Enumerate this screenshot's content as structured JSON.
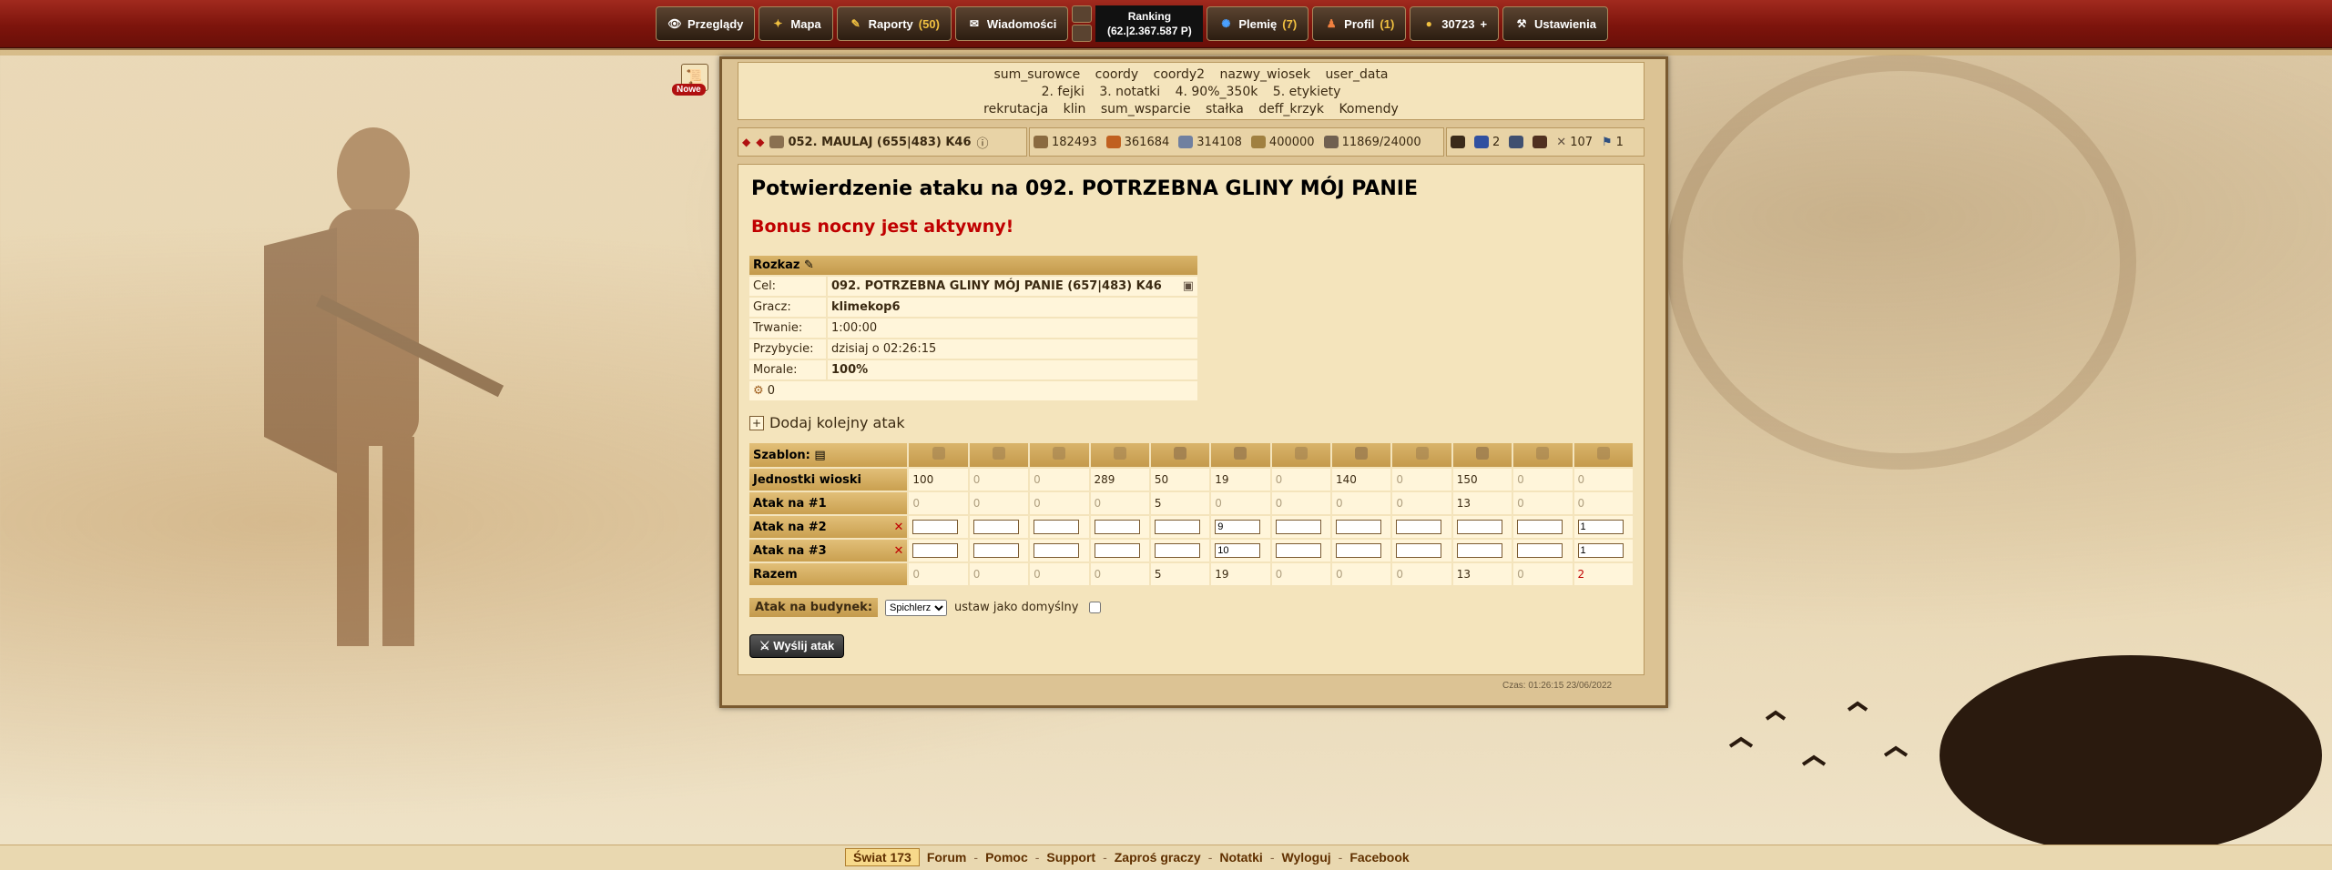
{
  "topbar": {
    "menu": [
      {
        "label": "Przeglądy",
        "count": ""
      },
      {
        "label": "Mapa",
        "count": ""
      },
      {
        "label": "Raporty",
        "count": "(50)"
      },
      {
        "label": "Wiadomości",
        "count": ""
      }
    ],
    "ranking_label": "Ranking",
    "ranking_value": "(62.|2.367.587 P)",
    "menu2": [
      {
        "label": "Plemię",
        "count": "(7)"
      },
      {
        "label": "Profil",
        "count": "(1)"
      },
      {
        "label": "30723",
        "count": "+"
      },
      {
        "label": "Ustawienia",
        "count": ""
      }
    ]
  },
  "quickbar": {
    "row1": [
      "sum_surowce",
      "coordy",
      "coordy2",
      "nazwy_wiosek",
      "user_data"
    ],
    "row2": [
      "2. fejki",
      "3. notatki",
      "4. 90%_350k",
      "5. etykiety"
    ],
    "row3": [
      "rekrutacja",
      "klin",
      "sum_wsparcie",
      "stałka",
      "deff_krzyk",
      "Komendy"
    ]
  },
  "badge_new": "Nowe",
  "village": {
    "name": "052. MAULAJ (655|483) K46"
  },
  "resources": {
    "wood": "182493",
    "clay": "361684",
    "iron": "314108",
    "storage": "400000",
    "farm": "11869/24000"
  },
  "icons_bar": {
    "count1": "2",
    "count2": "107",
    "count3": "1"
  },
  "page": {
    "title": "Potwierdzenie ataku na 092. POTRZEBNA GLINY MÓJ PANIE",
    "bonus": "Bonus nocny jest aktywny!"
  },
  "order": {
    "header": "Rozkaz",
    "rows": [
      {
        "label": "Cel:",
        "value": "092. POTRZEBNA GLINY MÓJ PANIE (657|483) K46"
      },
      {
        "label": "Gracz:",
        "value": "klimekop6"
      },
      {
        "label": "Trwanie:",
        "value": "1:00:00"
      },
      {
        "label": "Przybycie:",
        "value": "dzisiaj o 02:26:15"
      },
      {
        "label": "Morale:",
        "value": "100%"
      }
    ],
    "loot": "0"
  },
  "add_attack": "Dodaj kolejny atak",
  "units": {
    "template_label": "Szablon:",
    "rows": [
      {
        "label": "Jednostki wioski",
        "values": [
          "100",
          "0",
          "0",
          "289",
          "50",
          "19",
          "0",
          "140",
          "0",
          "150",
          "0",
          "0"
        ]
      },
      {
        "label": "Atak na #1",
        "values": [
          "0",
          "0",
          "0",
          "0",
          "5",
          "0",
          "0",
          "0",
          "0",
          "13",
          "0",
          "0"
        ]
      }
    ],
    "attack2": {
      "label": "Atak na #2",
      "inputs": [
        "",
        "",
        "",
        "",
        "",
        "9",
        "",
        "",
        "",
        "",
        "",
        "1"
      ]
    },
    "attack3": {
      "label": "Atak na #3",
      "inputs": [
        "",
        "",
        "",
        "",
        "",
        "10",
        "",
        "",
        "",
        "",
        "",
        "1"
      ]
    },
    "total": {
      "label": "Razem",
      "values": [
        "0",
        "0",
        "0",
        "0",
        "5",
        "19",
        "0",
        "0",
        "0",
        "13",
        "0",
        "2"
      ]
    }
  },
  "building": {
    "label": "Atak na budynek:",
    "selected": "Spichlerz",
    "default_label": "ustaw jako domyślny"
  },
  "send_button": "Wyślij atak",
  "server_time": "Czas: 01:26:15 23/06/2022",
  "footer": {
    "world": "Świat 173",
    "links": [
      "Forum",
      "Pomoc",
      "Support",
      "Zaproś graczy",
      "Notatki",
      "Wyloguj",
      "Facebook"
    ]
  }
}
